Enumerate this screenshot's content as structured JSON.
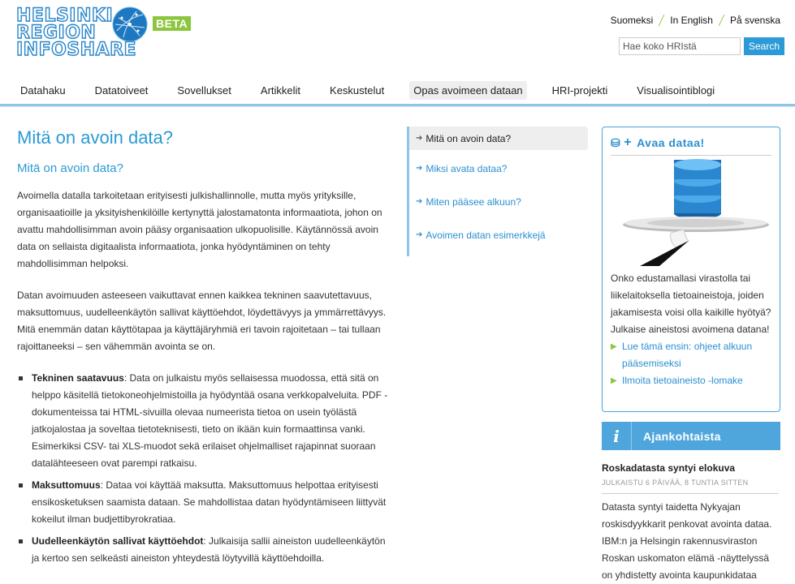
{
  "logo": {
    "lines": [
      "HELSINKI",
      "REGION",
      "INFOSHARE"
    ],
    "beta": "BETA"
  },
  "languages": [
    "Suomeksi",
    "In English",
    "På svenska"
  ],
  "search": {
    "placeholder": "Hae koko HRIstä",
    "button": "Search"
  },
  "nav": [
    {
      "label": "Datahaku",
      "active": false
    },
    {
      "label": "Datatoiveet",
      "active": false
    },
    {
      "label": "Sovellukset",
      "active": false
    },
    {
      "label": "Artikkelit",
      "active": false
    },
    {
      "label": "Keskustelut",
      "active": false
    },
    {
      "label": "Opas avoimeen dataan",
      "active": true
    },
    {
      "label": "HRI-projekti",
      "active": false
    },
    {
      "label": "Visualisointiblogi",
      "active": false
    }
  ],
  "main": {
    "title": "Mitä on avoin data?",
    "subtitle": "Mitä on avoin data?",
    "p1": "Avoimella datalla tarkoitetaan erityisesti julkishallinnolle, mutta myös yrityksille, organisaatioille ja yksityishenkilöille kertynyttä jalostamatonta informaatiota, johon on avattu mahdollisimman avoin pääsy organisaation ulkopuolisille. Käytännössä avoin data on sellaista digitaalista informaatiota, jonka hyödyntäminen on tehty mahdollisimman helpoksi.",
    "p2": "Datan avoimuuden asteeseen vaikuttavat ennen kaikkea tekninen saavutettavuus, maksuttomuus, uudelleenkäytön sallivat käyttöehdot, löydettävyys ja ymmärrettävyys. Mitä enemmän datan käyttötapaa ja käyttäjäryhmiä eri tavoin rajoitetaan – tai tullaan rajoittaneeksi – sen vähemmän avointa se on.",
    "bullets": [
      {
        "term": "Tekninen saatavuus",
        "text": ": Data on julkaistu myös sellaisessa muodossa, että sitä on helppo käsitellä tietokoneohjelmistoilla ja hyödyntää osana verkkopalveluita. PDF -dokumenteissa tai HTML-sivuilla olevaa numeerista tietoa on usein työlästä jatkojalostaa ja soveltaa tietoteknisesti, tieto on ikään kuin formaattinsa vanki. Esimerkiksi CSV- tai XLS-muodot sekä erilaiset ohjelmalliset rajapinnat suoraan datalähteeseen ovat parempi ratkaisu."
      },
      {
        "term": "Maksuttomuus",
        "text": ": Dataa voi käyttää maksutta. Maksuttomuus helpottaa erityisesti ensikosketuksen saamista dataan. Se mahdollistaa datan hyödyntämiseen liittyvät kokeilut ilman budjettibyrokratiaa."
      },
      {
        "term": "Uudelleenkäytön sallivat käyttöehdot",
        "text": ": Julkaisija sallii aineiston uudelleenkäytön ja kertoo sen selkeästi aineiston yhteydestä löytyvillä käyttöehdoilla."
      }
    ]
  },
  "subnav": [
    {
      "label": "Mitä on avoin data?",
      "current": true
    },
    {
      "label": "Miksi avata dataa?",
      "current": false
    },
    {
      "label": "Miten pääsee alkuun?",
      "current": false
    },
    {
      "label": "Avoimen datan esimerkkejä",
      "current": false
    }
  ],
  "databox": {
    "title": "Avaa dataa!",
    "text": "Onko edustamallasi virastolla tai liikelaitoksella tietoaineistoja, joiden jakamisesta voisi olla kaikille hyötyä? Julkaise aineistosi avoimena datana!",
    "links": [
      "Lue tämä ensin: ohjeet alkuun pääsemiseksi",
      "Ilmoita tietoaineisto -lomake"
    ]
  },
  "news": {
    "heading": "Ajankohtaista",
    "item_title": "Roskadatasta syntyi elokuva",
    "item_meta": "JULKAISTU 6 PÄIVÄÄ, 8 TUNTIA SITTEN",
    "item_body": "Datasta syntyi taidetta Nykyajan roskisdyykkarit penkovat avointa dataa. IBM:n ja Helsingin rakennusviraston Roskan uskomaton elämä -näyttelyssä on yhdistetty avointa kaupunkidataa"
  },
  "colors": {
    "accent": "#2b9ad6",
    "green": "#8cc63f",
    "nav_line": "#8ec6e8"
  }
}
